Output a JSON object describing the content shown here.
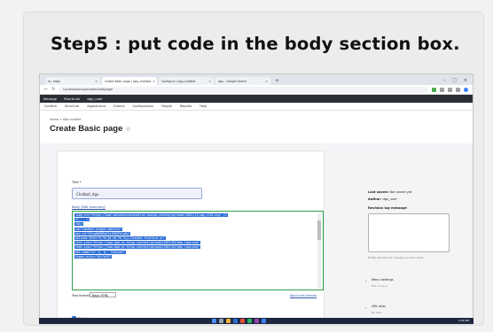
{
  "slide": {
    "title": "Step5 : put code in the body section box."
  },
  "browser": {
    "tabs": [
      {
        "label": "ec. edge"
      },
      {
        "label": "Create Basic page | dgu_chatbot"
      },
      {
        "label": "Configure | dgu_chatbot"
      },
      {
        "label": "dgu - Google Search"
      }
    ],
    "url": "localhost/drupal/node/add/page"
  },
  "drupal_toolbar": {
    "manage": "Manage",
    "shortcuts": "Shortcuts",
    "user": "dgu_user"
  },
  "admin_menu": {
    "items": [
      "Content",
      "Structure",
      "Appearance",
      "Extend",
      "Configuration",
      "People",
      "Reports",
      "Help"
    ]
  },
  "page": {
    "breadcrumb": "Home  >  Add content",
    "title": "Create Basic page",
    "title_label": "Title *",
    "title_value": "Chatbot_dgu",
    "body_label": "Body (Edit summary)",
    "code_lines": [
      "<img src=\"https://www.iotsensorinnovation.com/wp-content/uploads/2021/11/img_1155.png\" />",
      "<!-- -->",
      "<div",
      "    id=\"chatbot-widget-website\"",
      "    key-id=\"6IcaB8HN9sUIzfEBXPAlwMw\"",
      "    welcome-text=\"à¸ªà¸§à¸±à¸ªà¸à¸µ Chatbot Platform nr\"",
      "    text-icon=\"https://www.dga.or.th/wp-content/uploads/2021/03/dga_logo.png\"",
      "    chat-icon=\"https://www.dga.or.th/wp-content/uploads/2021/03/dga_logo.png\"",
      "    bot-name=\"à¹à¸à¸ Sikusen\"",
      "    theme-color=\"#1f3a70\""
    ],
    "text_format_label": "Text format",
    "text_format_value": "Basic HTML",
    "about_text_formats": "About text formats",
    "published_label": "Published"
  },
  "sidebar": {
    "last_saved_label": "Last saved:",
    "last_saved_value": "Not saved yet",
    "author_label": "Author:",
    "author_value": "dgu_user",
    "revision_label": "Revision log message",
    "revision_hint": "Briefly describe the changes you have made.",
    "menu_settings_label": "Menu settings",
    "menu_settings_value": "Not in menu",
    "url_alias_label": "URL alias",
    "url_alias_value": "No alias"
  },
  "taskbar": {
    "time": "4:26 PM"
  },
  "colors": {
    "accent": "#2aa04a",
    "selection": "#2f6fd6",
    "toolbar": "#2b2d36"
  }
}
